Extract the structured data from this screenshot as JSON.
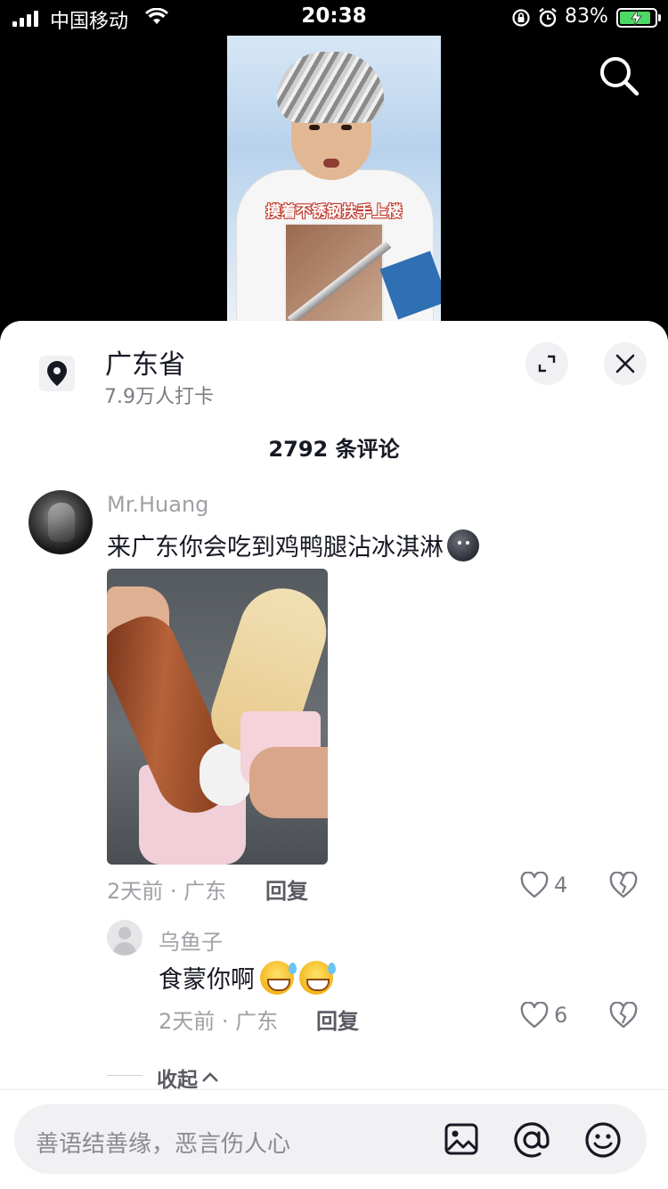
{
  "status_bar": {
    "carrier": "中国移动",
    "time": "20:38",
    "battery_percent": "83%"
  },
  "video": {
    "caption": "摸着不锈钢扶手上楼"
  },
  "location_panel": {
    "title": "广东省",
    "checkins": "7.9万人打卡",
    "comment_count": "2792 条评论"
  },
  "comments": [
    {
      "username": "Mr.Huang",
      "text": "来广东你会吃到鸡鸭腿沾冰淇淋",
      "time_location": "2天前 · 广东",
      "reply_label": "回复",
      "likes": "4",
      "replies": [
        {
          "username": "乌鱼子",
          "text": "食蒙你啊",
          "time_location": "2天前 · 广东",
          "reply_label": "回复",
          "likes": "6"
        }
      ]
    }
  ],
  "collapse_label": "收起",
  "input": {
    "placeholder": "善语结善缘，恶言伤人心"
  },
  "colors": {
    "panel_bg": "#ffffff",
    "text_primary": "#161823",
    "text_secondary": "#a0a1a6",
    "input_bg": "#f1f1f3",
    "battery_green": "#4cd964"
  }
}
